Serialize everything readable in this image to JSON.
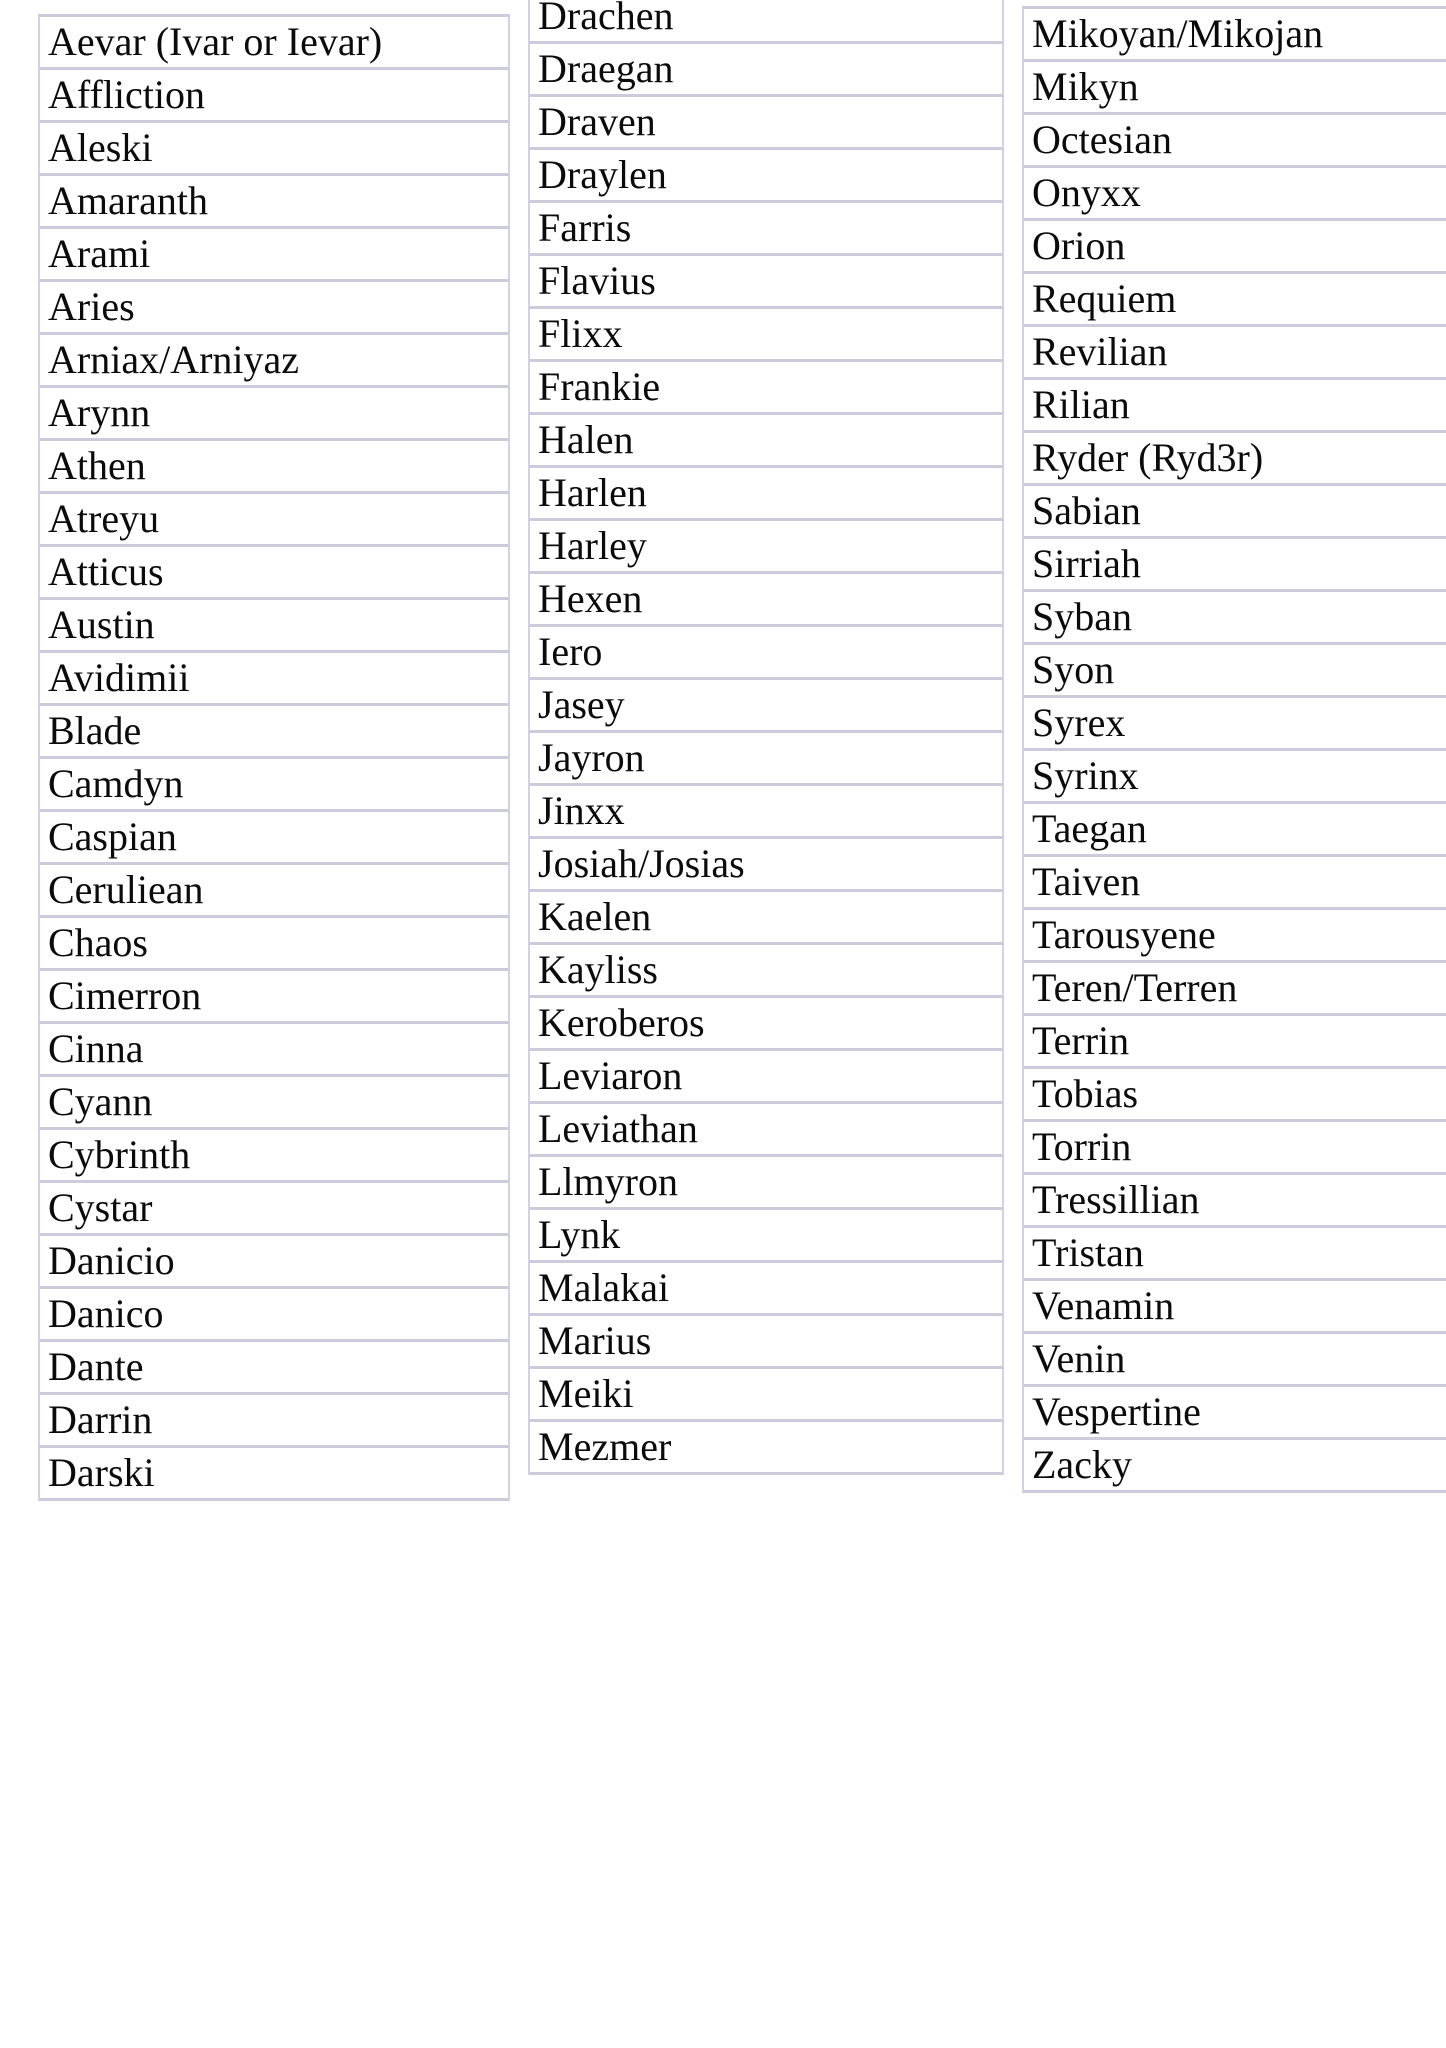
{
  "page": {
    "kind": "names-list-table",
    "background_color": "#ffffff",
    "text_color": "#0b0b0b",
    "border_color": "#ccccdd",
    "column_count": 3
  },
  "columns": [
    {
      "id": "column-1",
      "names": [
        "Aevar (Ivar or Ievar)",
        "Affliction",
        "Aleski",
        "Amaranth",
        "Arami",
        "Aries",
        "Arniax/Arniyaz",
        "Arynn",
        "Athen",
        "Atreyu",
        "Atticus",
        "Austin",
        "Avidimii",
        "Blade",
        "Camdyn",
        "Caspian",
        "Ceruliean",
        "Chaos",
        "Cimerron",
        "Cinna",
        "Cyann",
        "Cybrinth",
        "Cystar",
        "Danicio",
        "Danico",
        "Dante",
        "Darrin",
        "Darski"
      ]
    },
    {
      "id": "column-2",
      "names": [
        "Drachen",
        "Draegan",
        "Draven",
        "Draylen",
        "Farris",
        "Flavius",
        "Flixx",
        "Frankie",
        "Halen",
        "Harlen",
        "Harley",
        "Hexen",
        "Iero",
        "Jasey",
        "Jayron",
        "Jinxx",
        "Josiah/Josias",
        "Kaelen",
        "Kayliss",
        "Keroberos",
        "Leviaron",
        "Leviathan",
        "Llmyron",
        "Lynk",
        "Malakai",
        "Marius",
        "Meiki",
        "Mezmer"
      ]
    },
    {
      "id": "column-3",
      "names": [
        "Mikoyan/Mikojan",
        "Mikyn",
        "Octesian",
        "Onyxx",
        "Orion",
        "Requiem",
        "Revilian",
        "Rilian",
        "Ryder (Ryd3r)",
        "Sabian",
        "Sirriah",
        "Syban",
        "Syon",
        "Syrex",
        "Syrinx",
        "Taegan",
        "Taiven",
        "Tarousyene",
        "Teren/Terren",
        "Terrin",
        "Tobias",
        "Torrin",
        "Tressillian",
        "Tristan",
        "Venamin",
        "Venin",
        "Vespertine",
        "Zacky"
      ]
    }
  ]
}
